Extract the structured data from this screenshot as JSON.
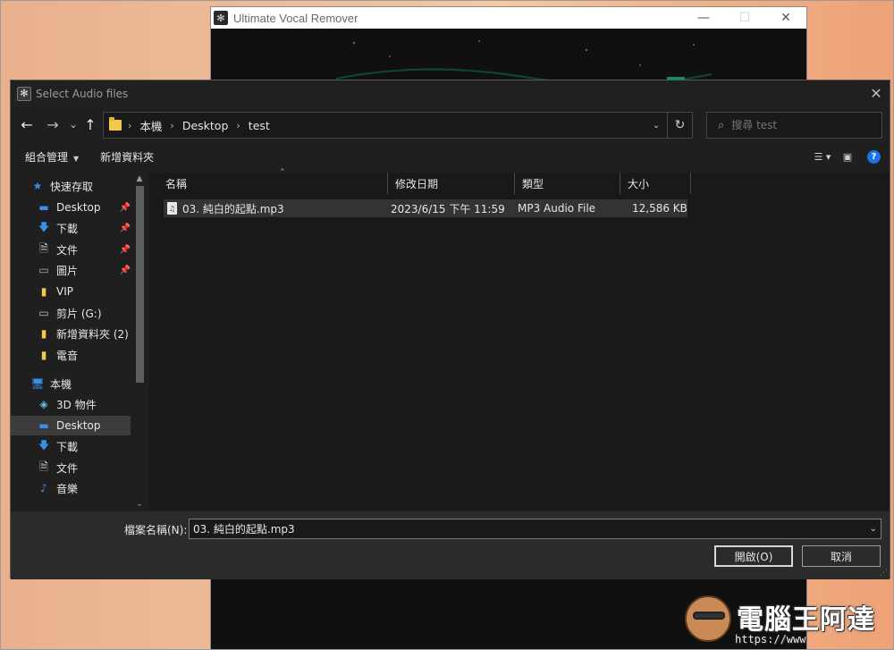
{
  "background_window": {
    "title": "Ultimate Vocal Remover",
    "logo": "uvr-logo-icon",
    "controls": [
      "—",
      "☐",
      "✕"
    ]
  },
  "dialog": {
    "title": "Select Audio files",
    "close_glyph": "✕",
    "nav": {
      "back": "←",
      "forward": "→",
      "recent": "⌄",
      "up": "↑",
      "breadcrumb": [
        "本機",
        "Desktop",
        "test"
      ],
      "search_placeholder": "搜尋 test",
      "refresh": "↻",
      "dropdown": "⌄"
    },
    "commands": {
      "organize": "組合管理",
      "new_folder": "新增資料夾",
      "caret": "▼"
    },
    "sidebar": {
      "quick_access": "快速存取",
      "quick_items": [
        {
          "label": "Desktop",
          "icon": "desktop-icon",
          "pinned": true
        },
        {
          "label": "下載",
          "icon": "download-icon",
          "pinned": true
        },
        {
          "label": "文件",
          "icon": "document-icon",
          "pinned": true
        },
        {
          "label": "圖片",
          "icon": "pictures-icon",
          "pinned": true
        },
        {
          "label": "VIP",
          "icon": "folder-icon",
          "pinned": false
        },
        {
          "label": "剪片 (G:)",
          "icon": "drive-icon",
          "pinned": false
        },
        {
          "label": "新增資料夾 (2)",
          "icon": "folder-icon",
          "pinned": false
        },
        {
          "label": "電音",
          "icon": "folder-icon",
          "pinned": false
        }
      ],
      "this_pc": "本機",
      "pc_items": [
        {
          "label": "3D 物件",
          "icon": "3d-objects-icon"
        },
        {
          "label": "Desktop",
          "icon": "desktop-icon",
          "selected": true
        },
        {
          "label": "下載",
          "icon": "download-icon"
        },
        {
          "label": "文件",
          "icon": "document-icon"
        },
        {
          "label": "音樂",
          "icon": "music-icon"
        }
      ]
    },
    "columns": [
      "名稱",
      "修改日期",
      "類型",
      "大小"
    ],
    "files": [
      {
        "name": "03. 純白的起點.mp3",
        "modified": "2023/6/15 下午 11:59",
        "type": "MP3 Audio File",
        "size": "12,586 KB"
      }
    ],
    "filename_label": "檔案名稱(N):",
    "filename_value": "03. 純白的起點.mp3",
    "open_button": "開啟(O)",
    "cancel_button": "取消"
  },
  "watermark": {
    "text": "電腦王阿達",
    "url": "https://www"
  }
}
